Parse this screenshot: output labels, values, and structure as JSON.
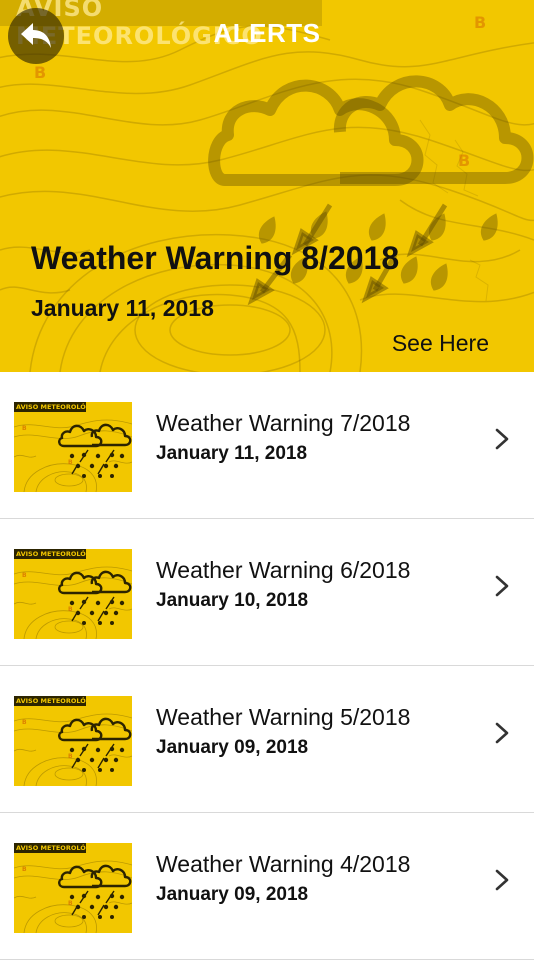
{
  "header": {
    "title": "ALERTS",
    "back_icon": "back-arrow-icon"
  },
  "featured": {
    "banner_text": "AVISO METEOROLÓGICO",
    "title": "Weather Warning 8/2018",
    "date": "January 11, 2018",
    "link_label": "See Here",
    "background_color": "#f2c700"
  },
  "alerts": [
    {
      "thumb_label": "AVISO METEOROLÓGICO",
      "title": "Weather Warning 7/2018",
      "date": "January 11, 2018"
    },
    {
      "thumb_label": "AVISO METEOROLÓGICO",
      "title": "Weather Warning 6/2018",
      "date": "January 10, 2018"
    },
    {
      "thumb_label": "AVISO METEOROLÓGICO",
      "title": "Weather Warning 5/2018",
      "date": "January 09, 2018"
    },
    {
      "thumb_label": "AVISO METEOROLÓGICO",
      "title": "Weather Warning 4/2018",
      "date": "January 09, 2018"
    }
  ],
  "colors": {
    "accent": "#f2c700",
    "text": "#111111",
    "divider": "#d9d9d9"
  }
}
